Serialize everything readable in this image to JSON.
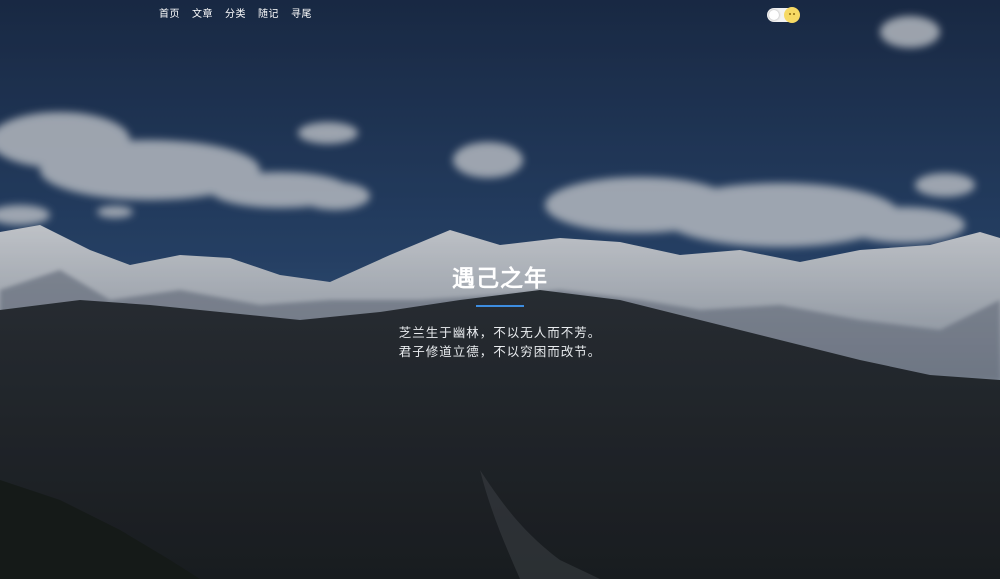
{
  "nav": {
    "items": [
      {
        "label": "首页"
      },
      {
        "label": "文章"
      },
      {
        "label": "分类"
      },
      {
        "label": "随记"
      },
      {
        "label": "寻尾"
      }
    ]
  },
  "theme_toggle": {
    "icon": "sun-icon"
  },
  "hero": {
    "title": "遇己之年",
    "motto": [
      "芝兰生于幽林，不以无人而不芳。",
      "君子修道立德，不以穷困而改节。"
    ]
  },
  "colors": {
    "accent": "#3d8de0",
    "sky": "#1f3a63",
    "toggle_sun": "#f6d964"
  }
}
